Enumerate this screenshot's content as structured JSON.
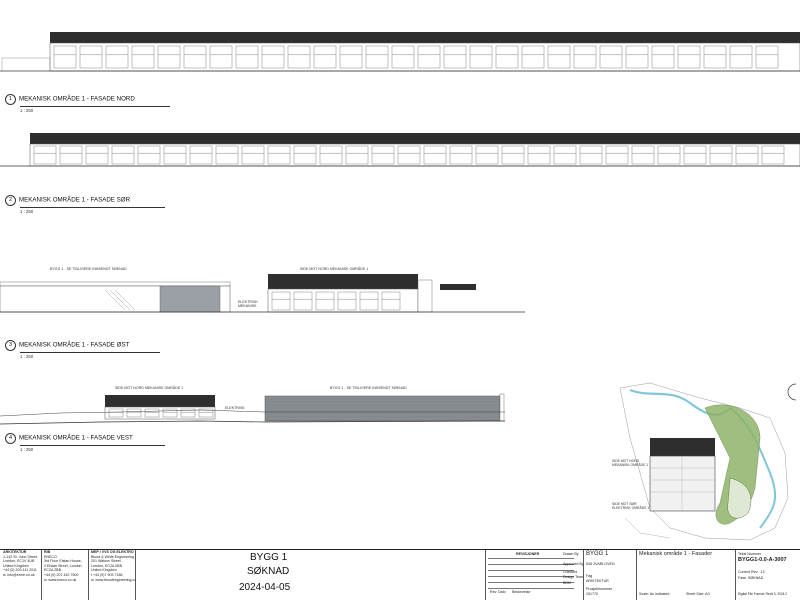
{
  "views": [
    {
      "number": "1",
      "title": "MEKANISK OMRÅDE 1 - FASADE NORD",
      "scale": "1 : 250"
    },
    {
      "number": "2",
      "title": "MEKANISK OMRÅDE 1 - FASADE SØR",
      "scale": "1 : 250"
    },
    {
      "number": "3",
      "title": "MEKANISK OMRÅDE 1 - FASADE ØST",
      "scale": "1 : 250"
    },
    {
      "number": "4",
      "title": "MEKANISK OMRÅDE 1 - FASADE VEST",
      "scale": "1 : 250"
    }
  ],
  "annotations": {
    "east_left": "BYGG 1 - SE TIDLIGERE INNSENDT SØKNAD",
    "east_right": "SIDE MOT NORD MEKANISK OMRÅDE 1",
    "east_center": "ELEKTRISK\nMEKANISK",
    "west_left": "SIDE MOT NORD MEKANISK OMRÅDE 1",
    "west_right": "BYGG 1 - SE TIDLIGERE INNSENDT SØKNAD",
    "west_center": "ELEKTRISK",
    "map_label_1": "SIDE MOT NORD\nMEKANISK OMRÅDE 1",
    "map_label_2": "SIDE MOT SØR\nELEKTRISK OMRÅDE 1"
  },
  "titleblock": {
    "col1": [
      "ARKITEKTUR",
      "1-142 St. John Street,",
      "London, EC1V 4UB",
      "United Kingdom",
      "+44 (0) 203 411 2011",
      "w. info@erme.co.uk"
    ],
    "col2": [
      "RIB",
      "ENECO",
      "3rd Floor Elstan House,",
      "2 Elstan Street, London",
      "EC2A 2BB",
      "+44 (0) 207 442 7600",
      "w. www.eneco.co.uk"
    ],
    "col3": [
      "MEP / VVS OG ELEKTRO",
      "Blood & White Engineering",
      "201 Watson Street",
      "London, EC2A 2BB",
      "United Kingdom",
      "t +44 (0)7 903 7186",
      "w. www.bloodengineering.com"
    ],
    "project_name": "BYGG 1",
    "project_status": "SØKNAD",
    "project_date": "2024-04-05",
    "revision_heading": "REVISJONER",
    "revision_cols": [
      "Rev",
      "Dato",
      "Beskrivelse",
      "Drawn By",
      "Approved By"
    ],
    "checked_label": "Checked",
    "checked_value": "Design Team",
    "approved_value": "BBM",
    "mid_project": "BYGG 1",
    "mid_code": "IND 2VARLOVEG",
    "mid_fag_label": "Fag",
    "mid_fag": "ARKITEKTUR",
    "mid_prosjekt_label": "Prosjektnummer",
    "mid_prosjekt": "151770",
    "sheet_title": "Mekanisk område 1 - Fasader",
    "scale_text": "Scale: As indicated",
    "sheet_size": "Sheet Size: A0",
    "drawing_label": "Tekst Nummer",
    "drawing_number": "BYGG1-0.0-A-3007",
    "current_rev_label": "Current Rev: -13",
    "status_label": "Fase: SØKNAD",
    "footer": "Digital File Format: Revit 3, 2024.2"
  },
  "colors": {
    "roof": "#2e2e2e",
    "line": "#555555",
    "facade_gray": "#8a8f94",
    "water": "#7fc6d8",
    "green": "#8fb36a"
  }
}
